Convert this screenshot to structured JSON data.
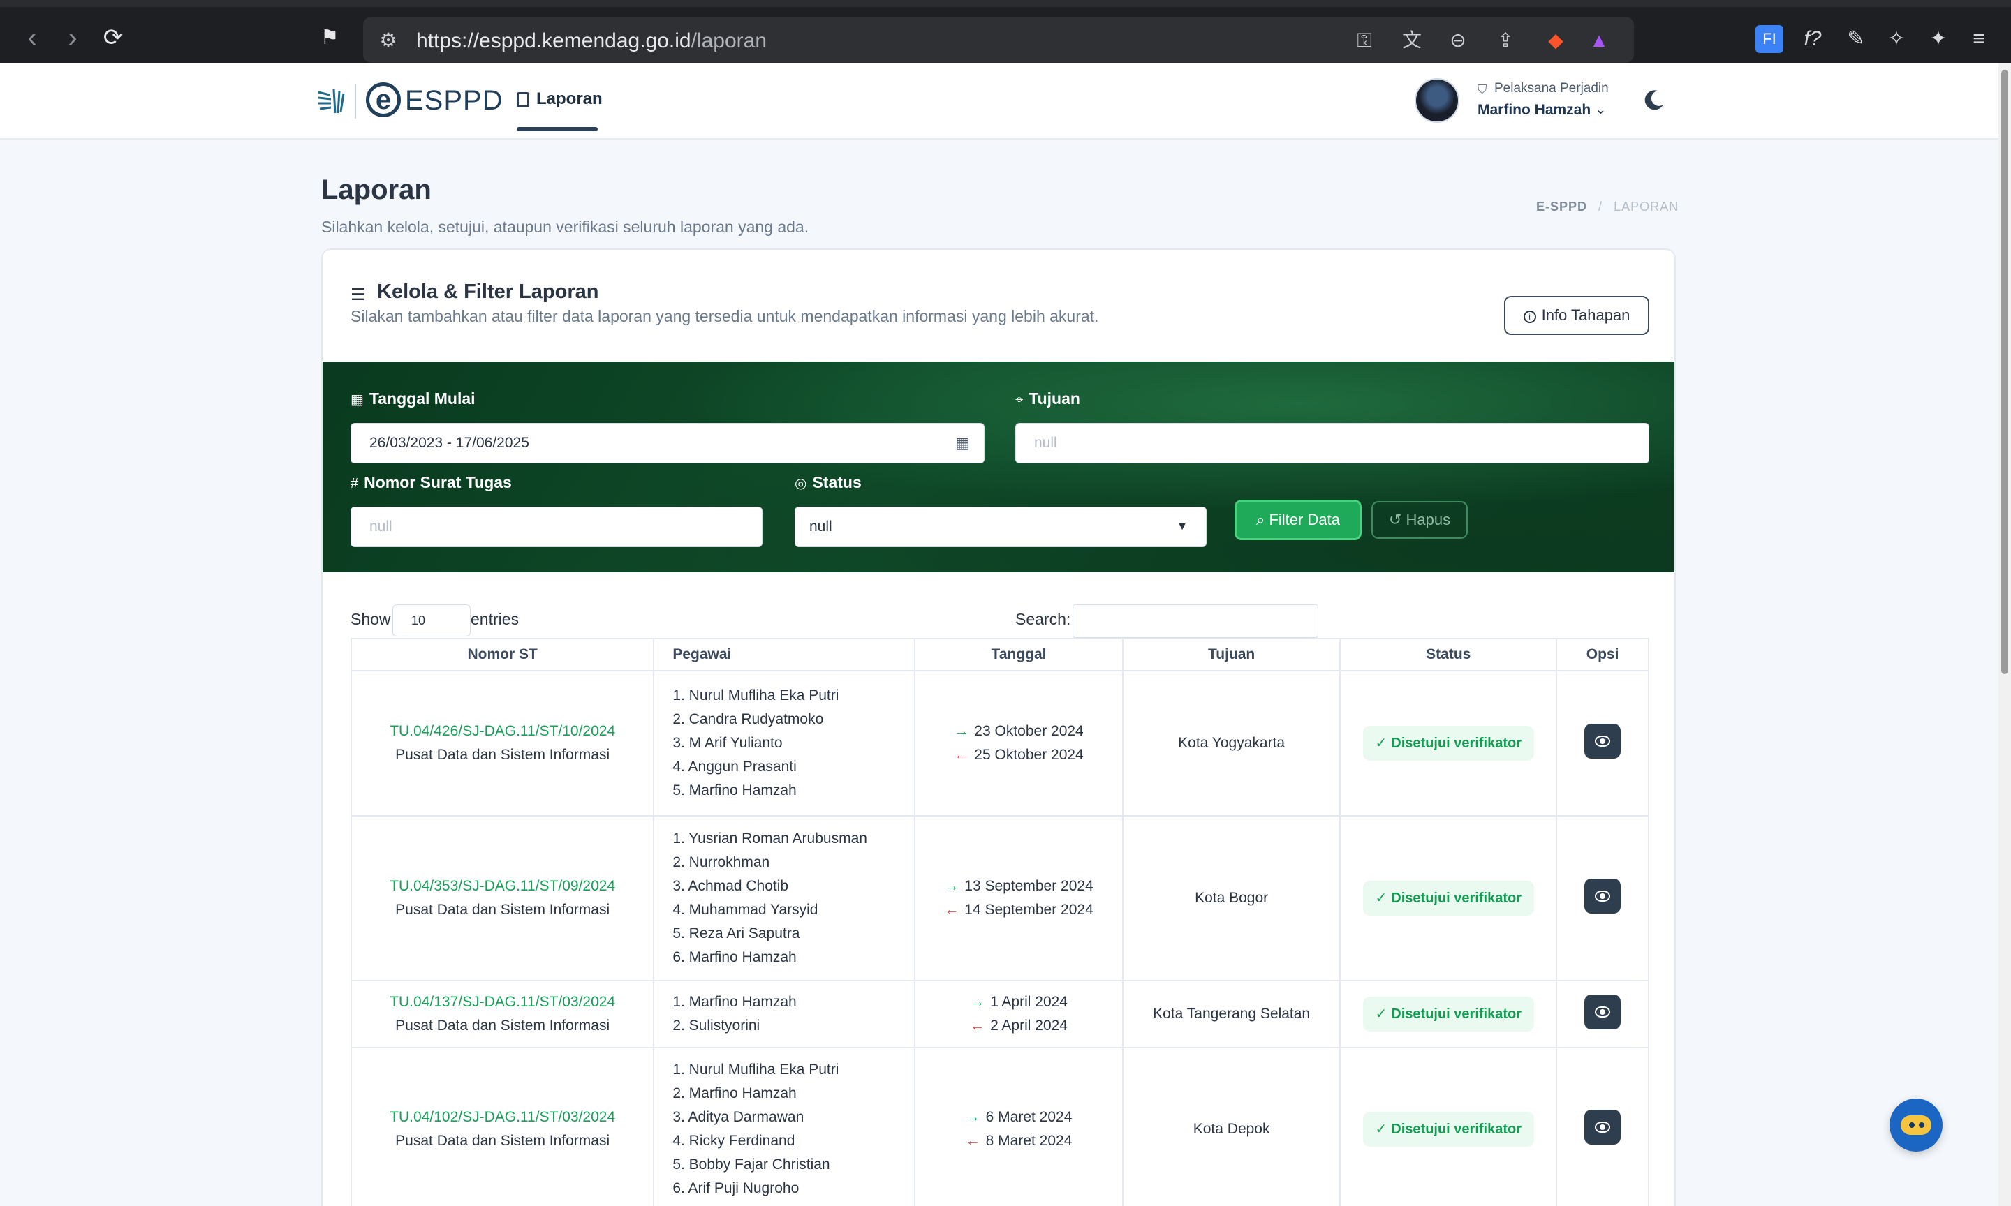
{
  "browser": {
    "url_host": "https://esppd.kemendag.go.id",
    "url_path": "/laporan"
  },
  "header": {
    "logo_text": "ESPPD",
    "nav_tab": "Laporan",
    "user_role": "Pelaksana Perjadin",
    "user_name": "Marfino Hamzah"
  },
  "page": {
    "title": "Laporan",
    "subtitle": "Silahkan kelola, setujui, ataupun verifikasi seluruh laporan yang ada.",
    "breadcrumb_root": "E-SPPD",
    "breadcrumb_sep": "/",
    "breadcrumb_current": "LAPORAN"
  },
  "card": {
    "title": "Kelola & Filter Laporan",
    "subtitle": "Silakan tambahkan atau filter data laporan yang tersedia untuk mendapatkan informasi yang lebih akurat.",
    "info_button": "Info Tahapan"
  },
  "filter": {
    "tanggal_label": "Tanggal Mulai",
    "tanggal_value": "26/03/2023 - 17/06/2025",
    "tujuan_label": "Tujuan",
    "tujuan_placeholder": "null",
    "nomor_label": "Nomor Surat Tugas",
    "nomor_placeholder": "null",
    "status_label": "Status",
    "status_value": "null",
    "filter_button": "Filter Data",
    "hapus_button": "Hapus"
  },
  "table_controls": {
    "show_label": "Show",
    "show_value": "10",
    "entries_label": "entries",
    "search_label": "Search:"
  },
  "table": {
    "headers": [
      "Nomor ST",
      "Pegawai",
      "Tanggal",
      "Tujuan",
      "Status",
      "Opsi"
    ],
    "rows": [
      {
        "nomor": "TU.04/426/SJ-DAG.11/ST/10/2024",
        "unit": "Pusat Data dan Sistem Informasi",
        "pegawai": [
          "1. Nurul Mufliha Eka Putri",
          "2. Candra Rudyatmoko",
          "3. M Arif Yulianto",
          "4. Anggun Prasanti",
          "5. Marfino Hamzah"
        ],
        "tgl_berangkat": "23 Oktober 2024",
        "tgl_kembali": "25 Oktober 2024",
        "tujuan": "Kota Yogyakarta",
        "status": "Disetujui verifikator"
      },
      {
        "nomor": "TU.04/353/SJ-DAG.11/ST/09/2024",
        "unit": "Pusat Data dan Sistem Informasi",
        "pegawai": [
          "1. Yusrian Roman Arubusman",
          "2. Nurrokhman",
          "3. Achmad Chotib",
          "4. Muhammad Yarsyid",
          "5. Reza Ari Saputra",
          "6. Marfino Hamzah"
        ],
        "tgl_berangkat": "13 September 2024",
        "tgl_kembali": "14 September 2024",
        "tujuan": "Kota Bogor",
        "status": "Disetujui verifikator"
      },
      {
        "nomor": "TU.04/137/SJ-DAG.11/ST/03/2024",
        "unit": "Pusat Data dan Sistem Informasi",
        "pegawai": [
          "1. Marfino Hamzah",
          "2. Sulistyorini"
        ],
        "tgl_berangkat": "1 April 2024",
        "tgl_kembali": "2 April 2024",
        "tujuan": "Kota Tangerang Selatan",
        "status": "Disetujui verifikator"
      },
      {
        "nomor": "TU.04/102/SJ-DAG.11/ST/03/2024",
        "unit": "Pusat Data dan Sistem Informasi",
        "pegawai": [
          "1. Nurul Mufliha Eka Putri",
          "2. Marfino Hamzah",
          "3. Aditya Darmawan",
          "4. Ricky Ferdinand",
          "5. Bobby Fajar Christian",
          "6. Arif Puji Nugroho"
        ],
        "tgl_berangkat": "6 Maret 2024",
        "tgl_kembali": "8 Maret 2024",
        "tujuan": "Kota Depok",
        "status": "Disetujui verifikator"
      }
    ]
  },
  "colors": {
    "accent_green": "#18a058",
    "filter_panel_bg": "#0f4d2a",
    "return_arrow": "#e24b4b"
  },
  "icons": {
    "back": "arrow-left-icon",
    "forward": "arrow-right-icon",
    "reload": "reload-icon",
    "bookmark": "bookmark-icon",
    "site_settings": "tune-icon",
    "key": "key-icon",
    "translate": "translate-icon",
    "zoom": "zoom-out-icon",
    "share": "share-icon",
    "moon": "moon-icon",
    "eye": "eye-icon",
    "chatbot": "chatbot-icon"
  }
}
